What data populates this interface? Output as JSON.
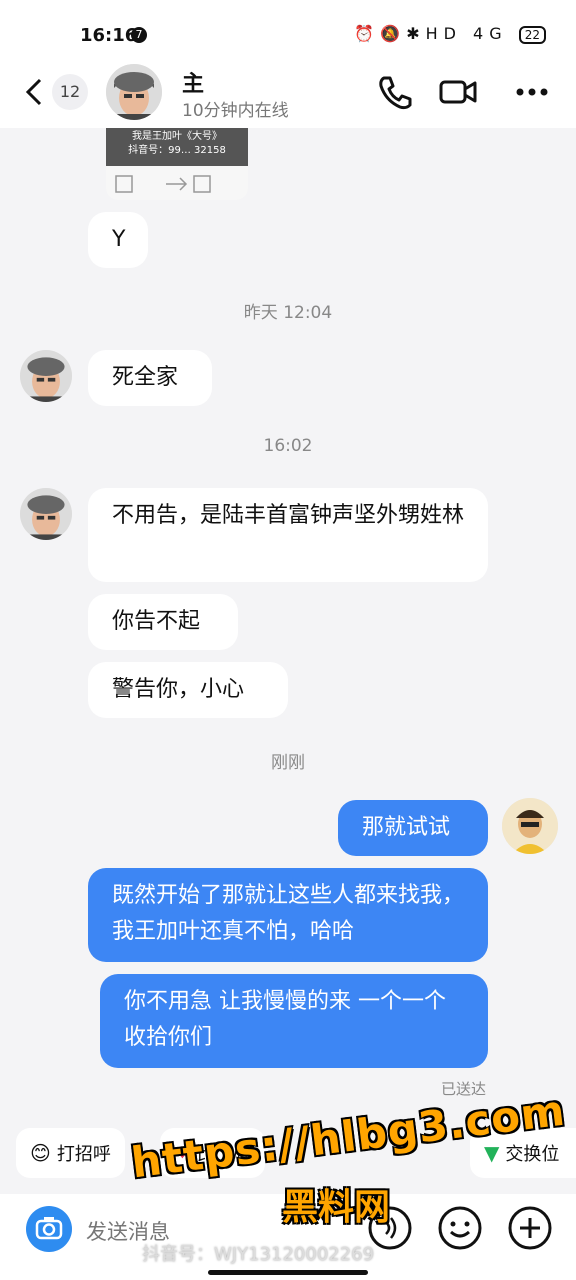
{
  "status": {
    "time": "16:16",
    "notif_count": "7",
    "battery": "22",
    "network": "HD 4G"
  },
  "header": {
    "back_count": "12",
    "name": "主",
    "online_status": "10分钟内在线"
  },
  "card": {
    "title": "我是王加叶《大号》",
    "sub": "抖音号：99… 32158"
  },
  "messages": [
    {
      "id": "m_y",
      "text": "Y",
      "side": "received"
    },
    {
      "id": "ts1",
      "text": "昨天 12:04",
      "type": "timestamp"
    },
    {
      "id": "m1",
      "text": "死全家",
      "side": "received"
    },
    {
      "id": "ts2",
      "text": "16:02",
      "type": "timestamp"
    },
    {
      "id": "m2",
      "text": "不用告，是陆丰首富钟声坚外甥姓林",
      "side": "received"
    },
    {
      "id": "m3",
      "text": "你告不起",
      "side": "received"
    },
    {
      "id": "m4",
      "text": "警告你，小心",
      "side": "received"
    },
    {
      "id": "ts3",
      "text": "刚刚",
      "type": "timestamp"
    },
    {
      "id": "m5",
      "text": "那就试试",
      "side": "sent"
    },
    {
      "id": "m6",
      "text": "既然开始了那就让这些人都来找我，我王加叶还真不怕，哈哈",
      "side": "sent"
    },
    {
      "id": "m7",
      "text": "你不用急 让我慢慢的来 一个一个收拾你们",
      "side": "sent"
    }
  ],
  "delivered": "已送达",
  "quick_actions": [
    {
      "label": "打招呼",
      "icon": "smile-emoji-icon"
    },
    {
      "label": "比个心",
      "icon": "heart-icon"
    },
    {
      "label": "交换位",
      "icon": "location-icon"
    }
  ],
  "input": {
    "placeholder": "发送消息"
  },
  "watermark": {
    "line1": "https://hlbg3.com",
    "line2": "黑料网",
    "douyin": "抖音号：WJY13120002269"
  },
  "colors": {
    "sent_bubble": "#3d86f4",
    "received_bubble": "#ffffff",
    "background": "#f4f4f6"
  }
}
